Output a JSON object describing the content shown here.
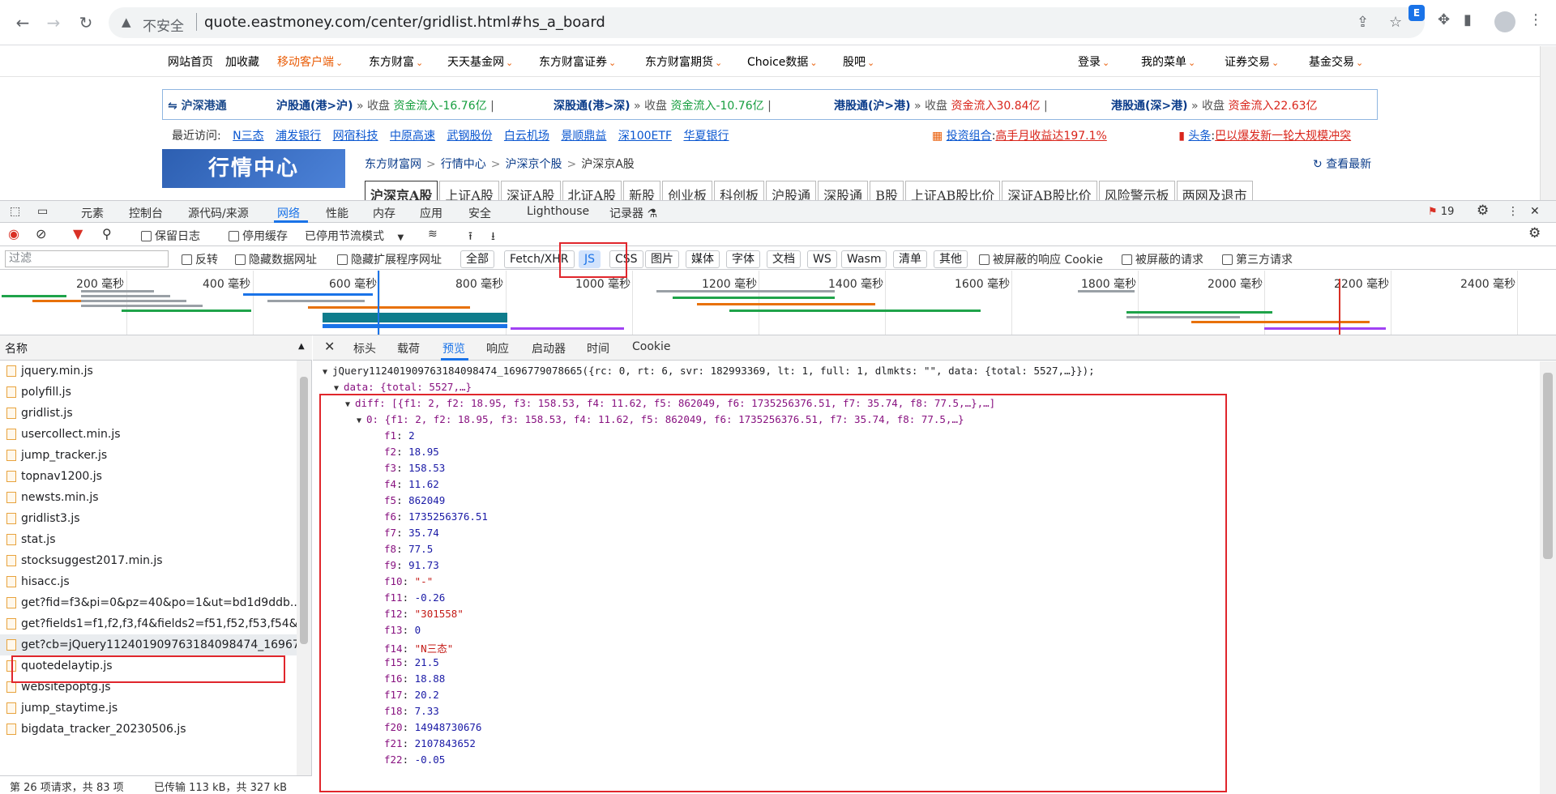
{
  "browser": {
    "security_label": "不安全",
    "url": "quote.eastmoney.com/center/gridlist.html#hs_a_board"
  },
  "site": {
    "nav": [
      "网站首页",
      "加收藏",
      "移动客户端",
      "东方财富",
      "天天基金网",
      "东方财富证券",
      "东方财富期货",
      "Choice数据",
      "股吧"
    ],
    "nav_right": [
      "登录",
      "我的菜单",
      "证券交易",
      "基金交易"
    ],
    "hk_title": "沪深港通",
    "hk_items": [
      {
        "name": "沪股通(港>沪)",
        "mid": "收盘",
        "flow": "资金流入-16.76亿"
      },
      {
        "name": "深股通(港>深)",
        "mid": "收盘",
        "flow": "资金流入-10.76亿"
      },
      {
        "name": "港股通(沪>港)",
        "mid": "收盘",
        "flow": "资金流入30.84亿"
      },
      {
        "name": "港股通(深>港)",
        "mid": "收盘",
        "flow": "资金流入22.63亿"
      }
    ],
    "recent_label": "最近访问:",
    "recent_links": [
      "N三态",
      "浦发银行",
      "网宿科技",
      "中原高速",
      "武钢股份",
      "白云机场",
      "景顺鼎益",
      "深100ETF",
      "华夏银行"
    ],
    "portfolio_link": "投资组合",
    "portfolio_text": "高手月收益达197.1%",
    "headline_link": "头条",
    "headline_text": "巴以爆发新一轮大规模冲突",
    "banner": "行情中心",
    "breadcrumb": [
      "东方财富网",
      "行情中心",
      "沪深京个股",
      "沪深京A股"
    ],
    "latest": "查看最新",
    "tabs": [
      "沪深京A股",
      "上证A股",
      "深证A股",
      "北证A股",
      "新股",
      "创业板",
      "科创板",
      "沪股通",
      "深股通",
      "B股",
      "上证AB股比价",
      "深证AB股比价",
      "风险警示板",
      "两网及退市"
    ]
  },
  "devtools": {
    "tabs": [
      "元素",
      "控制台",
      "源代码/来源",
      "网络",
      "性能",
      "内存",
      "应用",
      "安全",
      "Lighthouse",
      "记录器"
    ],
    "error_count": "19",
    "toolbar1": {
      "preserve_log": "保留日志",
      "disable_cache": "停用缓存",
      "throttle": "已停用节流模式"
    },
    "filter_placeholder": "过滤",
    "toolbar2": {
      "invert": "反转",
      "hide_data_urls": "隐藏数据网址",
      "hide_ext_urls": "隐藏扩展程序网址",
      "chips": [
        "全部",
        "Fetch/XHR",
        "JS",
        "CSS",
        "图片",
        "媒体",
        "字体",
        "文档",
        "WS",
        "Wasm",
        "清单",
        "其他"
      ],
      "blocked_cookies": "被屏蔽的响应 Cookie",
      "blocked_requests": "被屏蔽的请求",
      "third_party": "第三方请求"
    },
    "timeline_ticks": [
      "200 毫秒",
      "400 毫秒",
      "600 毫秒",
      "800 毫秒",
      "1000 毫秒",
      "1200 毫秒",
      "1400 毫秒",
      "1600 毫秒",
      "1800 毫秒",
      "2000 毫秒",
      "2200 毫秒",
      "2400 毫秒"
    ],
    "name_header": "名称",
    "requests": [
      "jquery.min.js",
      "polyfill.js",
      "gridlist.js",
      "usercollect.min.js",
      "jump_tracker.js",
      "topnav1200.js",
      "newsts.min.js",
      "gridlist3.js",
      "stat.js",
      "stocksuggest2017.min.js",
      "hisacc.js",
      "get?fid=f3&pi=0&pz=40&po=1&ut=bd1d9ddb...",
      "get?fields1=f1,f2,f3,f4&fields2=f51,f52,f53,f54&u...",
      "get?cb=jQuery112401909763184098474_16967...",
      "quotedelaytip.js",
      "websitepoptg.js",
      "jump_staytime.js",
      "bigdata_tracker_20230506.js"
    ],
    "status": {
      "requests": "第 26 项请求，共 83 项",
      "transferred": "已传输 113 kB，共 327 kB"
    },
    "detail_tabs": [
      "标头",
      "载荷",
      "预览",
      "响应",
      "启动器",
      "时间",
      "Cookie"
    ],
    "preview": {
      "root": "jQuery112401909763184098474_1696779078665({rc: 0, rt: 6, svr: 182993369, lt: 1, full: 1, dlmkts: \"\", data: {total: 5527,…}});",
      "data_line": "data: {total: 5527,…}",
      "diff_line": "diff: [{f1: 2, f2: 18.95, f3: 158.53, f4: 11.62, f5: 862049, f6: 1735256376.51, f7: 35.74, f8: 77.5,…},…]",
      "item0_line": "0: {f1: 2, f2: 18.95, f3: 158.53, f4: 11.62, f5: 862049, f6: 1735256376.51, f7: 35.74, f8: 77.5,…}",
      "fields": [
        {
          "k": "f1",
          "v": "2",
          "t": "n"
        },
        {
          "k": "f2",
          "v": "18.95",
          "t": "n"
        },
        {
          "k": "f3",
          "v": "158.53",
          "t": "n"
        },
        {
          "k": "f4",
          "v": "11.62",
          "t": "n"
        },
        {
          "k": "f5",
          "v": "862049",
          "t": "n"
        },
        {
          "k": "f6",
          "v": "1735256376.51",
          "t": "n"
        },
        {
          "k": "f7",
          "v": "35.74",
          "t": "n"
        },
        {
          "k": "f8",
          "v": "77.5",
          "t": "n"
        },
        {
          "k": "f9",
          "v": "91.73",
          "t": "n"
        },
        {
          "k": "f10",
          "v": "\"-\"",
          "t": "s"
        },
        {
          "k": "f11",
          "v": "-0.26",
          "t": "n"
        },
        {
          "k": "f12",
          "v": "\"301558\"",
          "t": "s"
        },
        {
          "k": "f13",
          "v": "0",
          "t": "n"
        },
        {
          "k": "f14",
          "v": "\"N三态\"",
          "t": "s"
        },
        {
          "k": "f15",
          "v": "21.5",
          "t": "n"
        },
        {
          "k": "f16",
          "v": "18.88",
          "t": "n"
        },
        {
          "k": "f17",
          "v": "20.2",
          "t": "n"
        },
        {
          "k": "f18",
          "v": "7.33",
          "t": "n"
        },
        {
          "k": "f20",
          "v": "14948730676",
          "t": "n"
        },
        {
          "k": "f21",
          "v": "2107843652",
          "t": "n"
        },
        {
          "k": "f22",
          "v": "-0.05",
          "t": "n"
        }
      ]
    }
  }
}
